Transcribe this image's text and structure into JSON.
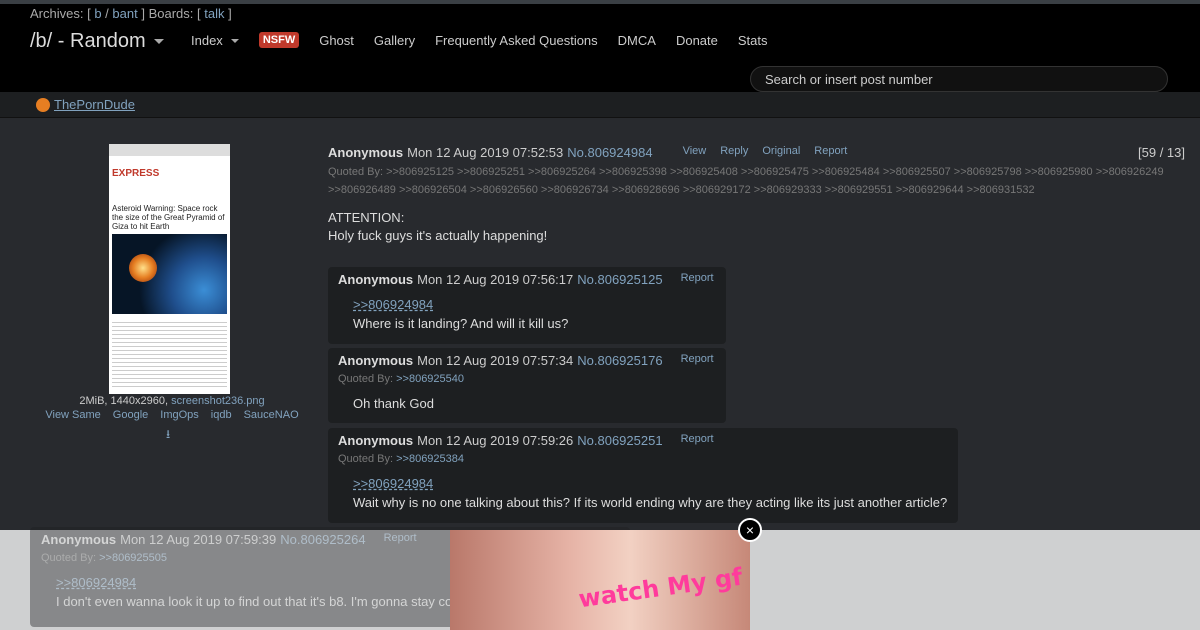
{
  "header": {
    "archives_prefix": "Archives: [",
    "archive_b": "b",
    "archive_sep": "/",
    "archive_bant": "bant",
    "boards_prefix": "] Boards: [",
    "board_talk": "talk",
    "boards_suffix": "]",
    "board_title": "/b/ - Random",
    "nav": {
      "index": "Index",
      "nsfw": "NSFW",
      "ghost": "Ghost",
      "gallery": "Gallery",
      "faq": "Frequently Asked Questions",
      "dmca": "DMCA",
      "donate": "Donate",
      "stats": "Stats"
    },
    "search_placeholder": "Search or insert post number"
  },
  "ad_link": {
    "label": "ThePornDude"
  },
  "op": {
    "file_info": "2MiB, 1440x2960,",
    "file_name": "screenshot236.png",
    "file_tools": [
      "View Same",
      "Google",
      "ImgOps",
      "iqdb",
      "SauceNAO"
    ],
    "thumb": {
      "site": "EXPRESS",
      "headline": "Asteroid Warning: Space rock the size of the Great Pyramid of Giza to hit Earth"
    },
    "name": "Anonymous",
    "date": "Mon 12 Aug 2019 07:52:53",
    "number": "No.806924984",
    "tools": [
      "View",
      "Reply",
      "Original",
      "Report"
    ],
    "counter": "[59 / 13]",
    "quoted_by": "Quoted By: >>806925125 >>806925251 >>806925264 >>806925398 >>806925408 >>806925475 >>806925484 >>806925507 >>806925798 >>806925980 >>806926249 >>806926489 >>806926504 >>806926560 >>806926734 >>806928696 >>806929172 >>806929333 >>806929551 >>806929644 >>806931532",
    "body_line1": "ATTENTION:",
    "body_line2": "Holy fuck guys it's actually happening!"
  },
  "replies": [
    {
      "name": "Anonymous",
      "date": "Mon 12 Aug 2019 07:56:17",
      "number": "No.806925125",
      "report": "Report",
      "quoted_by": "",
      "quote": ">>806924984",
      "text": "Where is it landing? And will it kill us?"
    },
    {
      "name": "Anonymous",
      "date": "Mon 12 Aug 2019 07:57:34",
      "number": "No.806925176",
      "report": "Report",
      "quoted_by_label": "Quoted By:",
      "quoted_by": ">>806925540",
      "quote": "",
      "text": "Oh thank God"
    },
    {
      "name": "Anonymous",
      "date": "Mon 12 Aug 2019 07:59:26",
      "number": "No.806925251",
      "report": "Report",
      "quoted_by_label": "Quoted By:",
      "quoted_by": ">>806925384",
      "quote": ">>806924984",
      "text": "Wait why is no one talking about this? If its world ending why are they acting like its just another article?"
    },
    {
      "name": "Anonymous",
      "date": "Mon 12 Aug 2019 07:59:39",
      "number": "No.806925264",
      "report": "Report",
      "quoted_by_label": "Quoted By:",
      "quoted_by": ">>806925505",
      "quote": ">>806924984",
      "text": "I don't even wanna look it up to find out that it's b8. I'm gonna stay co"
    }
  ],
  "overlay_ad": {
    "logo": "watch My gf",
    "close": "×"
  },
  "colors": {
    "background": "#282a2e",
    "link": "#81a2be",
    "nsfw": "#c0392b",
    "topbar": "#000000"
  }
}
